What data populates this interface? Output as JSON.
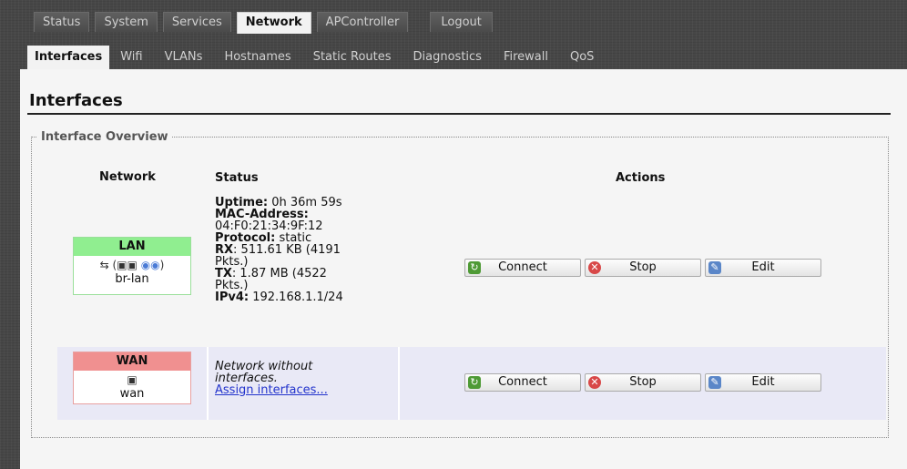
{
  "top_tabs": [
    "Status",
    "System",
    "Services",
    "Network",
    "APController",
    "Logout"
  ],
  "sub_tabs": [
    "Interfaces",
    "Wifi",
    "VLANs",
    "Hostnames",
    "Static Routes",
    "Diagnostics",
    "Firewall",
    "QoS"
  ],
  "page": {
    "title": "Interfaces",
    "section": "Interface Overview",
    "headers": {
      "network": "Network",
      "status": "Status",
      "actions": "Actions"
    }
  },
  "lan": {
    "name": "LAN",
    "color": "#90ee90",
    "device": "br-lan",
    "uptime_label": "Uptime:",
    "uptime": "0h 36m 59s",
    "mac_label": "MAC-Address:",
    "mac": "04:F0:21:34:9F:12",
    "protocol_label": "Protocol:",
    "protocol": "static",
    "rx_label": "RX",
    "rx_line1": ": 511.61 KB (4191",
    "rx_line2": "Pkts.)",
    "tx_label": "TX",
    "tx_line1": ": 1.87 MB (4522",
    "tx_line2": "Pkts.)",
    "ipv4_label": "IPv4:",
    "ipv4": "192.168.1.1/24"
  },
  "wan": {
    "name": "WAN",
    "color": "#f09090",
    "device": "wan",
    "status_line1": "Network without",
    "status_line2": "interfaces.",
    "assign_link": "Assign interfaces..."
  },
  "actions": {
    "connect": "Connect",
    "stop": "Stop",
    "edit": "Edit"
  }
}
